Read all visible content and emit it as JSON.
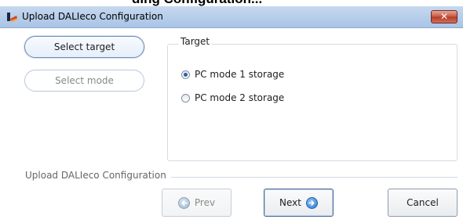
{
  "window": {
    "title": "Upload DALIeco Configuration",
    "close_glyph": "✕",
    "icon": "app-icon",
    "accent_color": "#2a5fa8"
  },
  "steps": [
    {
      "label": "Select target",
      "state": "active"
    },
    {
      "label": "Select mode",
      "state": "disabled"
    }
  ],
  "target_group": {
    "label": "Target",
    "options": [
      {
        "label": "PC mode 1 storage",
        "checked": true
      },
      {
        "label": "PC mode 2 storage",
        "checked": false
      }
    ]
  },
  "wizard": {
    "section_label": "Upload DALIeco Configuration"
  },
  "buttons": {
    "prev": "Prev",
    "next": "Next",
    "cancel": "Cancel"
  }
}
